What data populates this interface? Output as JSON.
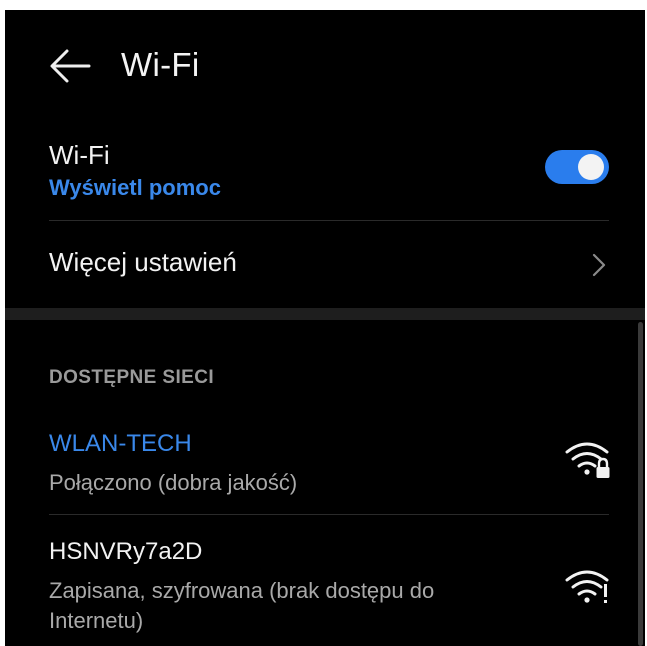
{
  "header": {
    "title": "Wi-Fi",
    "back_icon": "arrow-left-icon"
  },
  "wifi_toggle": {
    "label": "Wi-Fi",
    "help_link": "Wyświetl pomoc",
    "enabled": true,
    "accent_color": "#2a7ded"
  },
  "more_settings": {
    "label": "Więcej ustawień",
    "icon": "chevron-right-icon"
  },
  "networks": {
    "section_title": "DOSTĘPNE SIECI",
    "items": [
      {
        "name": "WLAN-TECH",
        "status": "Połączono (dobra jakość)",
        "connected": true,
        "icon": "wifi-lock-icon"
      },
      {
        "name": "HSNVRy7a2D",
        "status": "Zapisana, szyfrowana (brak dostępu do Internetu)",
        "connected": false,
        "icon": "wifi-no-internet-icon"
      }
    ]
  }
}
